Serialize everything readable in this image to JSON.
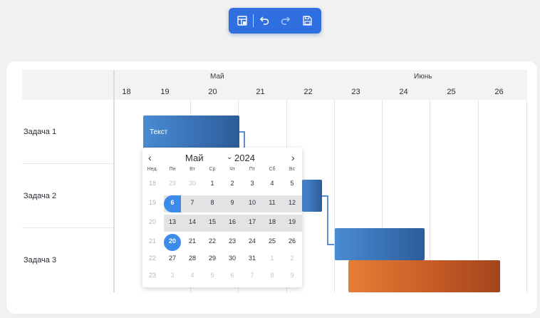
{
  "toolbar": {
    "buttons": [
      {
        "name": "table-layout-icon",
        "glyph": "table"
      },
      {
        "name": "undo-icon",
        "glyph": "undo"
      },
      {
        "name": "redo-icon",
        "glyph": "redo"
      },
      {
        "name": "save-icon",
        "glyph": "save"
      }
    ],
    "accent": "#2f6fe0"
  },
  "gantt": {
    "months": [
      {
        "label": "Май"
      },
      {
        "label": "Июнь"
      }
    ],
    "days": [
      "18",
      "19",
      "20",
      "21",
      "22",
      "23",
      "24",
      "25",
      "26"
    ],
    "tasks": [
      {
        "label": "Задача 1"
      },
      {
        "label": "Задача 2"
      },
      {
        "label": "Задача 3"
      }
    ],
    "bar_text": "Текст",
    "colors": {
      "blue": "#3b74b8",
      "orange": "#c75c27"
    }
  },
  "datepicker": {
    "prev": "‹",
    "next": "›",
    "month": "Май",
    "caret": "⌄",
    "year": "2024",
    "weekdays": [
      "Нед.",
      "Пн",
      "Вт",
      "Ср",
      "Чт",
      "Пт",
      "Сб",
      "Вс"
    ],
    "rows": [
      [
        "18",
        "29",
        "30",
        "1",
        "2",
        "3",
        "4",
        "5"
      ],
      [
        "19",
        "6",
        "7",
        "8",
        "9",
        "10",
        "11",
        "12"
      ],
      [
        "20",
        "13",
        "14",
        "15",
        "16",
        "17",
        "18",
        "19"
      ],
      [
        "21",
        "20",
        "21",
        "22",
        "23",
        "24",
        "25",
        "26"
      ],
      [
        "22",
        "27",
        "28",
        "29",
        "30",
        "31",
        "1",
        "2"
      ],
      [
        "23",
        "3",
        "4",
        "5",
        "6",
        "7",
        "8",
        "9"
      ]
    ],
    "selected_start": "6",
    "selected_end": "20",
    "selection_color": "#3d8be8"
  }
}
